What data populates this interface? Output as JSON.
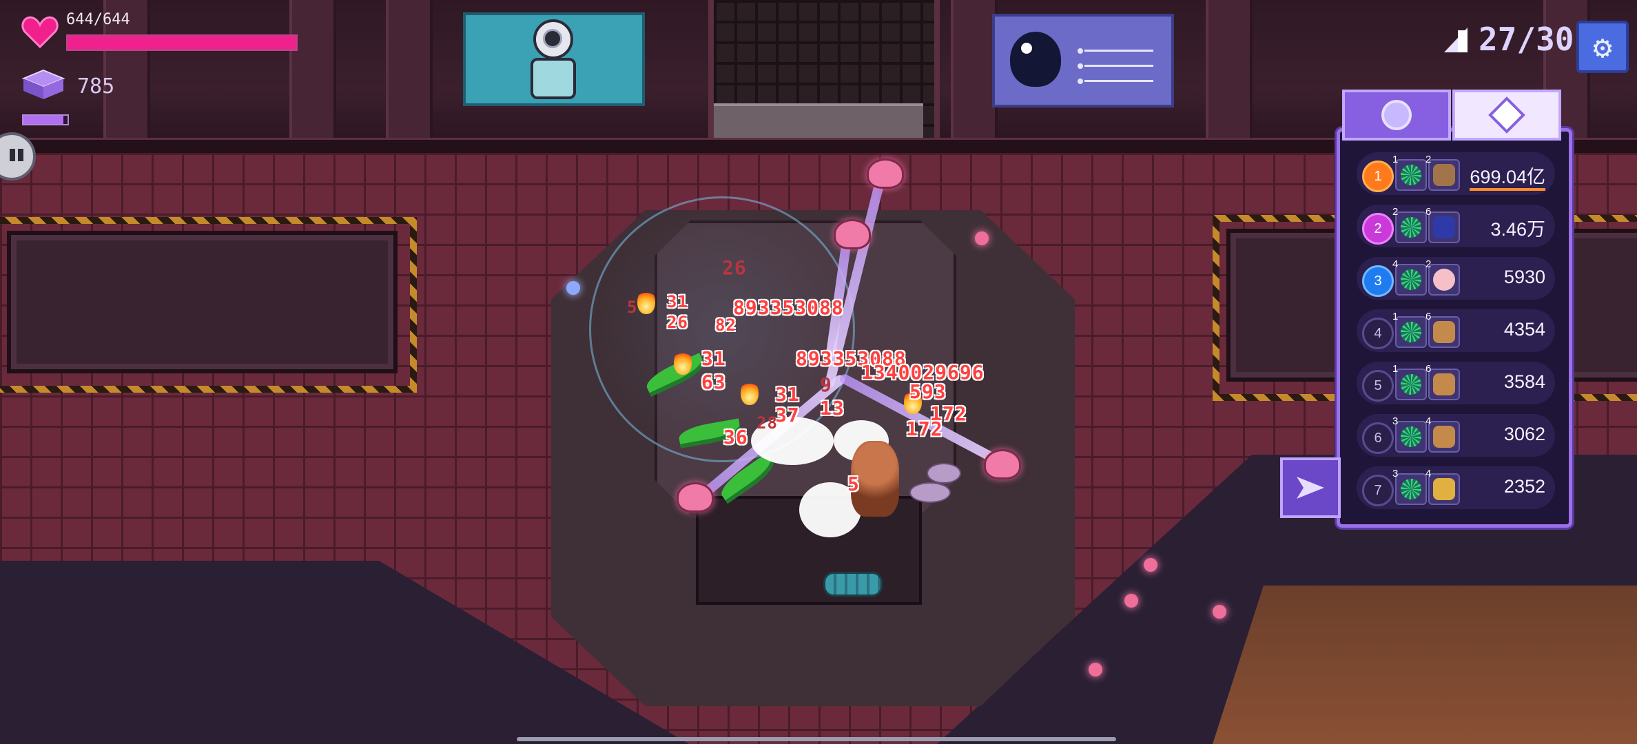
{
  "hud": {
    "hp_text": "644/644",
    "hp_fraction": 1.0,
    "gems_text": "785",
    "energy_fraction": 0.9,
    "wave_text": "27/30"
  },
  "damage_numbers": [
    "26",
    "893353088",
    "31",
    "26",
    "82",
    "5",
    "31",
    "63",
    "893353088",
    "1340029696",
    "593",
    "31",
    "37",
    "13",
    "172",
    "172",
    "36",
    "28",
    "5",
    "9"
  ],
  "leaderboard": {
    "tabs": [
      "circle-tab",
      "diamond-tab"
    ],
    "active_tab": 1,
    "rows": [
      {
        "rank": "1",
        "gear_level": "1",
        "weapon_level": "2",
        "value": "699.04亿"
      },
      {
        "rank": "2",
        "gear_level": "2",
        "weapon_level": "6",
        "value": "3.46万"
      },
      {
        "rank": "3",
        "gear_level": "4",
        "weapon_level": "2",
        "value": "5930"
      },
      {
        "rank": "4",
        "gear_level": "1",
        "weapon_level": "6",
        "value": "4354"
      },
      {
        "rank": "5",
        "gear_level": "1",
        "weapon_level": "6",
        "value": "3584"
      },
      {
        "rank": "6",
        "gear_level": "3",
        "weapon_level": "4",
        "value": "3062"
      },
      {
        "rank": "7",
        "gear_level": "3",
        "weapon_level": "4",
        "value": "2352"
      }
    ]
  },
  "colors": {
    "hp": "#f0208c",
    "energy": "#b070f0",
    "panel_accent": "#9b70e8",
    "damage_text": "#ff4040"
  }
}
